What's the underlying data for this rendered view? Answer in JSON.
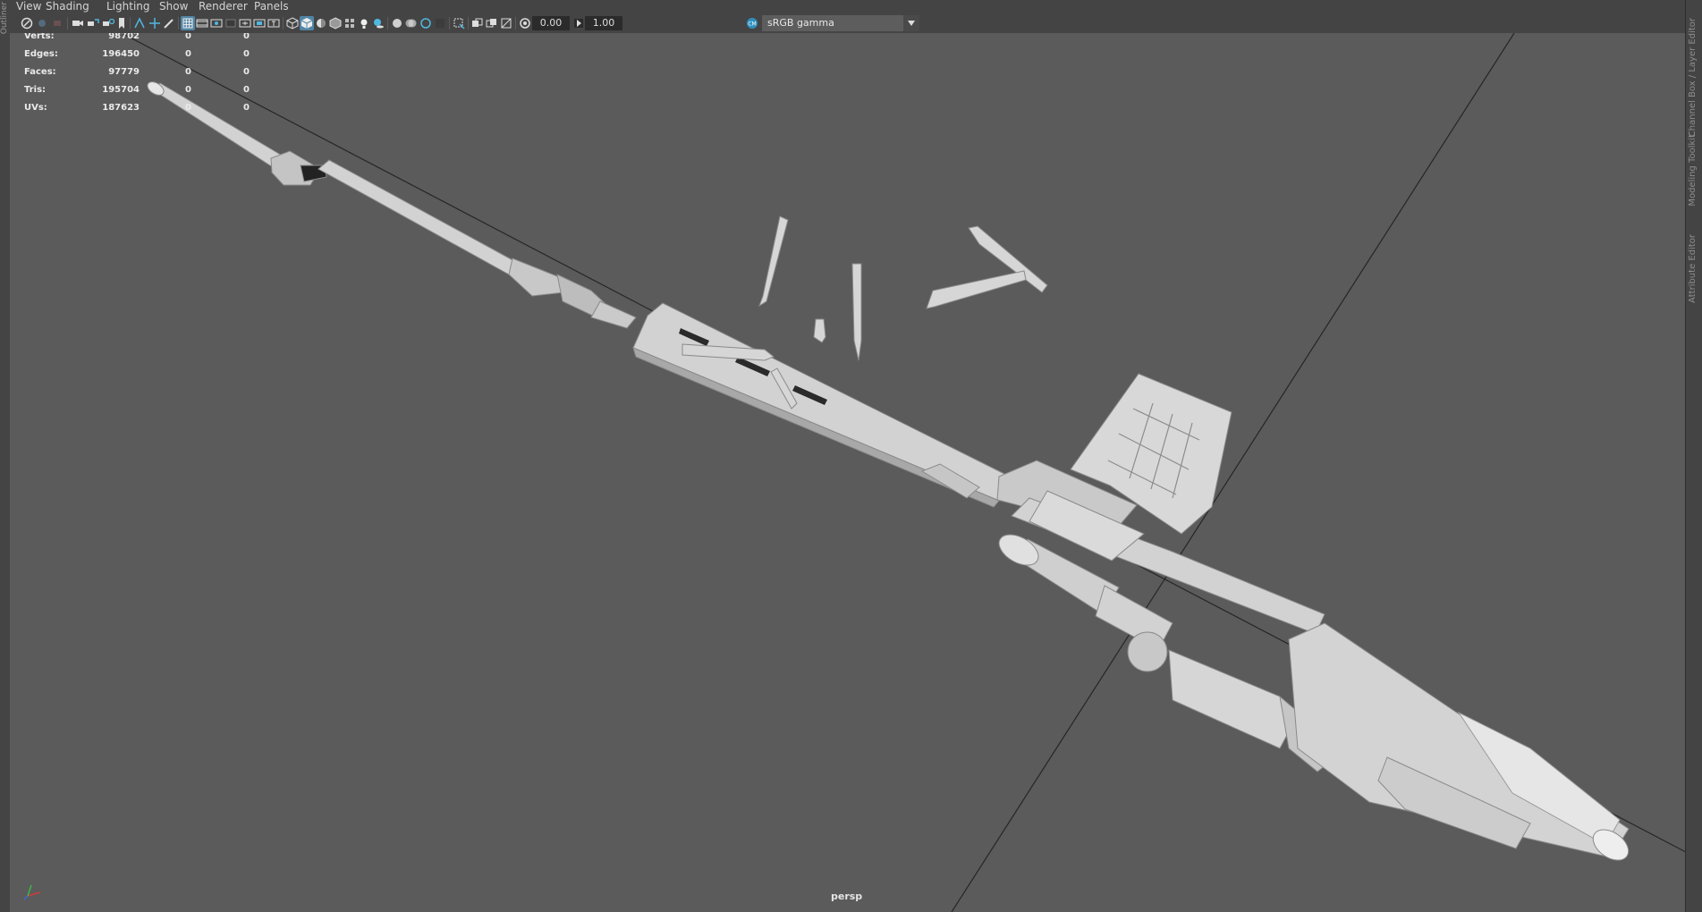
{
  "menu": {
    "items": [
      "View",
      "Shading",
      "Lighting",
      "Show",
      "Renderer",
      "Panels"
    ]
  },
  "toolbar": {
    "exposure": "0.00",
    "gamma": "1.00",
    "color_space": "sRGB gamma",
    "icons": [
      "select-camera-icon",
      "camera-attributes-icon",
      "bookmark-icon",
      "grid-icon",
      "film-gate-icon",
      "resolution-gate-icon",
      "wireframe-icon",
      "smooth-shade-icon",
      "lighting-icon",
      "shadows-icon",
      "xray-icon",
      "isolate-icon",
      "color-management-icon"
    ]
  },
  "hud": {
    "rows": [
      {
        "label": "Verts:",
        "v1": "98702",
        "v2": "0",
        "v3": "0"
      },
      {
        "label": "Edges:",
        "v1": "196450",
        "v2": "0",
        "v3": "0"
      },
      {
        "label": "Faces:",
        "v1": "97779",
        "v2": "0",
        "v3": "0"
      },
      {
        "label": "Tris:",
        "v1": "195704",
        "v2": "0",
        "v3": "0"
      },
      {
        "label": "UVs:",
        "v1": "187623",
        "v2": "0",
        "v3": "0"
      }
    ]
  },
  "viewport": {
    "camera": "persp",
    "background_color": "#5b5b5b",
    "model_color": "#d0d0d0"
  },
  "left_panel": {
    "tab": "Outliner"
  },
  "right_panel": {
    "tabs": [
      "Channel Box / Layer Editor",
      "Modeling Toolkit",
      "Attribute Editor"
    ]
  },
  "colors": {
    "ui_bg": "#444444",
    "active_button": "#5285a6",
    "field_bg": "#2b2b2b"
  }
}
